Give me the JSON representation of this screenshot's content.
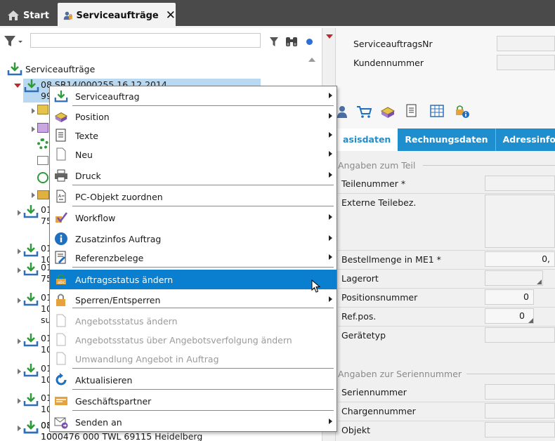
{
  "tabs": [
    {
      "label": "Start",
      "icon": "home-icon"
    },
    {
      "label": "Serviceaufträge",
      "icon": "service-user-icon",
      "close": "✕"
    }
  ],
  "tree": {
    "root_label": "Serviceaufträge",
    "selected_line1": "08.SR14/000255 16.12.2014",
    "selected_line2": "99",
    "rows": [
      {
        "l1": "01",
        "l2": "75"
      },
      {
        "l1": "01",
        "l2": "10"
      },
      {
        "l1": "01",
        "l2": "75"
      },
      {
        "l1": "01",
        "l2": "10",
        "l3": "su"
      },
      {
        "l1": "01",
        "l2": "10"
      },
      {
        "l1": "01",
        "l2": "10"
      },
      {
        "l1": "01",
        "l2": "10"
      },
      {
        "l1": "01",
        "l2": "10"
      },
      {
        "l1": "08",
        "l2": "1000476 000 TWL 69115 Heidelberg"
      }
    ]
  },
  "header_fields": {
    "order_no_label": "ServiceauftragsNr",
    "customer_no_label": "Kundennummer"
  },
  "detail_tabs": [
    "asisdaten",
    "Rechnungsdaten",
    "Adressinforma"
  ],
  "part_section": {
    "legend": "Angaben zum Teil",
    "labels": [
      "Teilenummer *",
      "Externe Teilebez.",
      "Bestellmenge in ME1 *",
      "Lagerort",
      "Positionsnummer",
      "Ref.pos.",
      "Gerätetyp"
    ],
    "order_qty_value": "0,",
    "position_no_value": "0",
    "ref_pos_value": "0"
  },
  "serial_section": {
    "legend": "Angaben zur Seriennummer",
    "labels": [
      "Seriennummer",
      "Chargennummer",
      "Objekt"
    ]
  },
  "menu": {
    "items": [
      {
        "label": "Serviceauftrag",
        "icon": "download-arrow-icon",
        "submenu": true
      },
      {
        "label": "Position",
        "icon": "position-cubes-icon",
        "submenu": true
      },
      {
        "label": "Texte",
        "icon": "document-text-icon",
        "submenu": true
      },
      {
        "label": "Neu",
        "icon": "blank-document-icon",
        "submenu": true
      },
      {
        "label": "Druck",
        "icon": "printer-icon",
        "submenu": true
      },
      {
        "label": "PC-Objekt zuordnen",
        "icon": "attach-document-icon",
        "submenu": false
      },
      {
        "label": "Workflow",
        "icon": "workflow-check-icon",
        "submenu": true
      },
      {
        "label": "Zusatzinfos Auftrag",
        "icon": "info-icon",
        "submenu": true
      },
      {
        "label": "Referenzbelege",
        "icon": "reference-document-icon",
        "submenu": true
      },
      {
        "label": "Auftragsstatus ändern",
        "icon": "status-change-icon",
        "submenu": false
      },
      {
        "label": "Sperren/Entsperren",
        "icon": "lock-icon",
        "submenu": true
      },
      {
        "label": "Angebotsstatus ändern",
        "icon": "blank-document-icon",
        "submenu": false
      },
      {
        "label": "Angebotsstatus über Angebotsverfolgung ändern",
        "icon": "blank-document-icon",
        "submenu": false
      },
      {
        "label": "Umwandlung Angebot in Auftrag",
        "icon": "blank-document-icon",
        "submenu": false
      },
      {
        "label": "Aktualisieren",
        "icon": "refresh-icon",
        "submenu": false
      },
      {
        "label": "Geschäftspartner",
        "icon": "business-partner-card-icon",
        "submenu": false
      },
      {
        "label": "Senden an",
        "icon": "send-envelope-icon",
        "submenu": true
      }
    ]
  },
  "colors": {
    "accent": "#1f8ecf",
    "highlight": "#0a7fcf",
    "selection": "#b9d9f2",
    "tabbar": "#4a4a4a",
    "icon_green": "#2e9a3a"
  }
}
